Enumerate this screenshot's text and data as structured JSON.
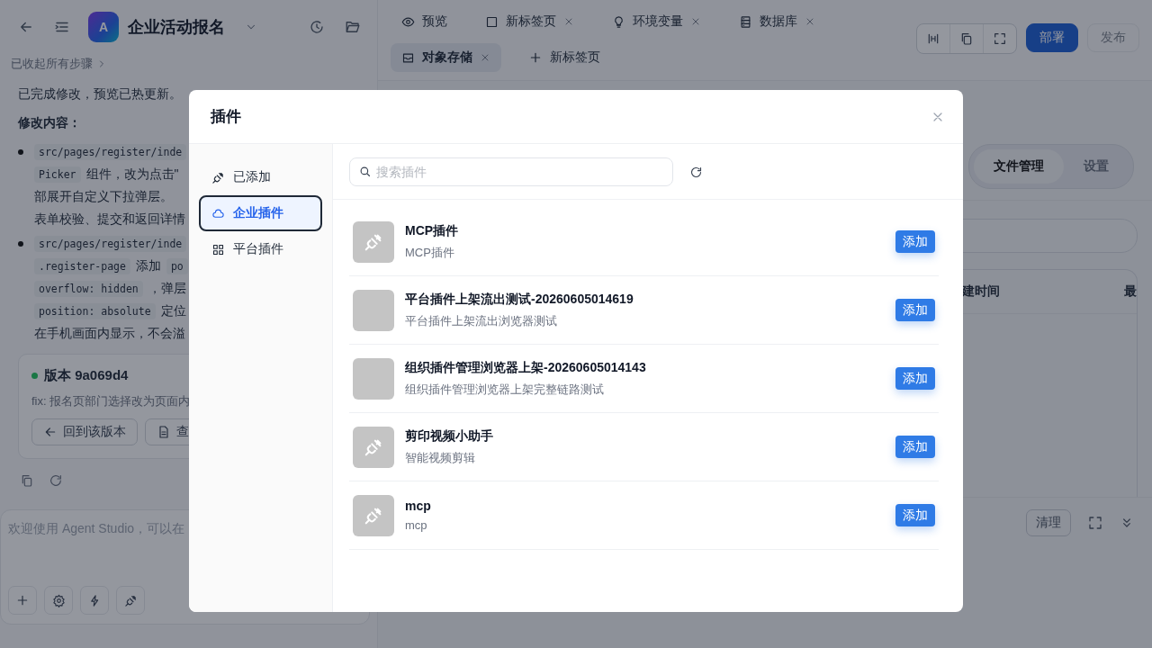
{
  "app_header": {
    "avatar_letter": "A",
    "title": "企业活动报名"
  },
  "steps_toggle": "已收起所有步骤",
  "message": {
    "intro": "已完成修改，预览已热更新。",
    "heading": "修改内容：",
    "bullets": [
      {
        "lines": [
          [
            {
              "kind": "code",
              "text": "src/pages/register/inde"
            }
          ],
          [
            {
              "kind": "code",
              "text": "Picker"
            },
            {
              "kind": "text",
              "text": "组件，改为点击\""
            }
          ],
          [
            {
              "kind": "text",
              "text": "部展开自定义下拉弹层。"
            }
          ],
          [
            {
              "kind": "text",
              "text": "表单校验、提交和返回详情"
            }
          ]
        ]
      },
      {
        "lines": [
          [
            {
              "kind": "code",
              "text": "src/pages/register/inde"
            }
          ],
          [
            {
              "kind": "code",
              "text": ".register-page"
            },
            {
              "kind": "text",
              "text": "添加"
            },
            {
              "kind": "code",
              "text": "po"
            }
          ],
          [
            {
              "kind": "code",
              "text": "overflow: hidden"
            },
            {
              "kind": "text",
              "text": "，弹层"
            }
          ],
          [
            {
              "kind": "code",
              "text": "position: absolute"
            },
            {
              "kind": "text",
              "text": "定位"
            }
          ],
          [
            {
              "kind": "text",
              "text": "在手机画面内显示，不会溢"
            }
          ]
        ]
      }
    ]
  },
  "version_card": {
    "title": "版本 9a069d4",
    "summary": "fix: 报名页部门选择改为页面内",
    "buttons": [
      {
        "label": "回到该版本",
        "kind": "back"
      },
      {
        "label": "查",
        "kind": "file"
      }
    ]
  },
  "chat_input": {
    "placeholder": "欢迎使用 Agent Studio，可以在"
  },
  "tab_rows": [
    [
      {
        "label": "预览",
        "kind": "eye",
        "closable": false,
        "selected": false
      },
      {
        "label": "新标签页",
        "kind": "square",
        "closable": true,
        "selected": false
      },
      {
        "label": "环境变量",
        "kind": "bulb",
        "closable": true,
        "selected": false
      },
      {
        "label": "数据库",
        "kind": "db",
        "closable": true,
        "selected": false
      }
    ],
    [
      {
        "label": "对象存储",
        "kind": "box",
        "closable": true,
        "selected": true
      }
    ]
  ],
  "new_tab": "新标签页",
  "actions": [
    {
      "label": "部署",
      "disabled": false
    },
    {
      "label": "发布",
      "disabled": true
    }
  ],
  "panel_tabs": [
    {
      "label": "文件管理",
      "selected": true
    },
    {
      "label": "设置",
      "selected": false
    }
  ],
  "table": {
    "columns": [
      "建时间",
      "最"
    ]
  },
  "clear_button": "清理",
  "modal": {
    "title": "插件",
    "categories": [
      {
        "label": "已添加",
        "kind": "plug",
        "selected": false
      },
      {
        "label": "企业插件",
        "kind": "cloud",
        "selected": true
      },
      {
        "label": "平台插件",
        "kind": "grid",
        "selected": false
      }
    ],
    "search": {
      "placeholder": "搜索插件"
    },
    "plugins": [
      {
        "name": "MCP插件",
        "description": "MCP插件",
        "kind": "plug",
        "button": "添加"
      },
      {
        "name": "平台插件上架流出测试-20260605014619",
        "description": "平台插件上架流出浏览器测试",
        "kind": "blank",
        "button": "添加"
      },
      {
        "name": "组织插件管理浏览器上架-20260605014143",
        "description": "组织插件管理浏览器上架完整链路测试",
        "kind": "blank",
        "button": "添加"
      },
      {
        "name": "剪印视频小助手",
        "description": "智能视频剪辑",
        "kind": "plug",
        "button": "添加"
      },
      {
        "name": "mcp",
        "description": "mcp",
        "kind": "plug",
        "button": "添加"
      }
    ]
  }
}
